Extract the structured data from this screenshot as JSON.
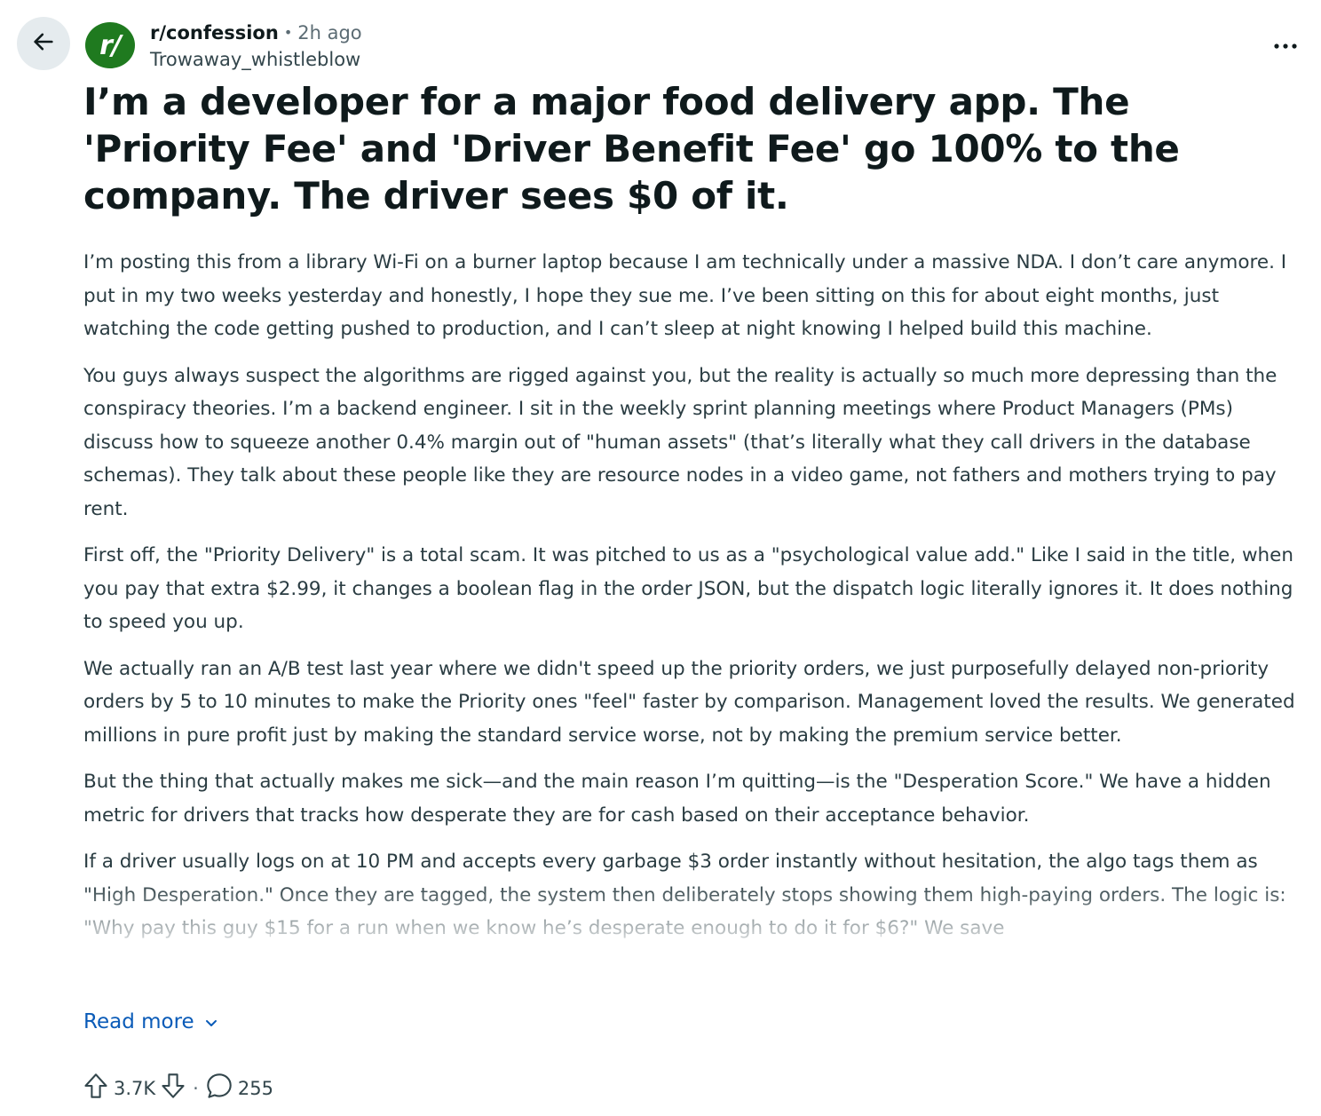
{
  "header": {
    "subreddit": "r/confession",
    "separator": "•",
    "time": "2h ago",
    "author": "Trowaway_whistleblow",
    "avatar_text": "r/"
  },
  "icons": {
    "back": "arrow-left-icon",
    "more": "ellipsis-horizontal-icon",
    "upvote": "arrow-up-icon",
    "downvote": "arrow-down-icon",
    "comments": "speech-bubble-icon",
    "read_more_chevron": "chevron-down-icon"
  },
  "post": {
    "title": "I’m a developer for a major food delivery app. The 'Priority Fee' and 'Driver Benefit Fee' go 100% to the company. The driver sees $0 of it.",
    "paragraphs": [
      "I’m posting this from a library Wi-Fi on a burner laptop because I am technically under a massive NDA. I don’t care anymore. I put in my two weeks yesterday and honestly, I hope they sue me. I’ve been sitting on this for about eight months, just watching the code getting pushed to production, and I can’t sleep at night knowing I helped build this machine.",
      "You guys always suspect the algorithms are rigged against you, but the reality is actually so much more depressing than the conspiracy theories. I’m a backend engineer. I sit in the weekly sprint planning meetings where Product Managers (PMs) discuss how to squeeze another 0.4% margin out of \"human assets\" (that’s literally what they call drivers in the database schemas). They talk about these people like they are resource nodes in a video game, not fathers and mothers trying to pay rent.",
      "First off, the \"Priority Delivery\" is a total scam. It was pitched to us as a \"psychological value add.\" Like I said in the title, when you pay that extra $2.99, it changes a boolean flag in the order JSON, but the dispatch logic literally ignores it. It does nothing to speed you up.",
      "We actually ran an A/B test last year where we didn't speed up the priority orders, we just purposefully delayed non-priority orders by 5 to 10 minutes to make the Priority ones \"feel\" faster by comparison. Management loved the results. We generated millions in pure profit just by making the standard service worse, not by making the premium service better.",
      "But the thing that actually makes me sick—and the main reason I’m quitting—is the \"Desperation Score.\" We have a hidden metric for drivers that tracks how desperate they are for cash based on their acceptance behavior.",
      "If a driver usually logs on at 10 PM and accepts every garbage $3 order instantly without hesitation, the algo tags them as \"High Desperation.\" Once they are tagged, the system then deliberately stops showing them high-paying orders. The logic is: \"Why pay this guy $15 for a run when we know he’s desperate enough to do it for $6?\" We save"
    ],
    "read_more_label": "Read more"
  },
  "actions": {
    "upvotes": "3.7K",
    "separator": "·",
    "comments": "255"
  },
  "colors": {
    "avatar_bg": "#1f7a1f",
    "back_button_bg": "#e5ebee",
    "link": "#0a5bb8",
    "text": "#0f1a1c",
    "muted": "#5c6c74"
  }
}
